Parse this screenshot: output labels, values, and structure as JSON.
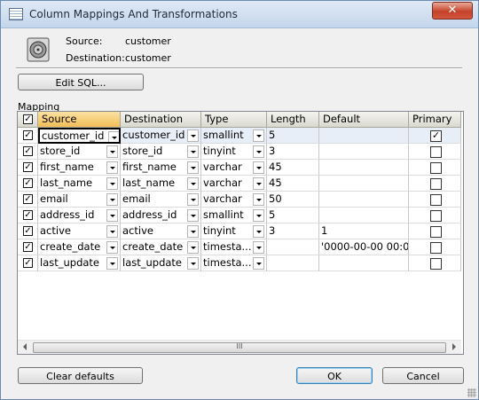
{
  "window": {
    "title": "Column Mappings And Transformations",
    "close_label": "✕"
  },
  "info": {
    "source_label": "Source:",
    "source_value": "customer",
    "destination_label": "Destination:",
    "destination_value": "customer"
  },
  "buttons": {
    "edit_sql": "Edit SQL...",
    "clear_defaults": "Clear defaults",
    "ok": "OK",
    "cancel": "Cancel"
  },
  "mapping_label": "Mapping",
  "columns": {
    "source": "Source",
    "destination": "Destination",
    "type": "Type",
    "length": "Length",
    "default": "Default",
    "primary": "Primary"
  },
  "rows": [
    {
      "checked": true,
      "source": "customer_id",
      "destination": "customer_id",
      "type": "smallint",
      "length": "5",
      "default": "",
      "primary": true
    },
    {
      "checked": true,
      "source": "store_id",
      "destination": "store_id",
      "type": "tinyint",
      "length": "3",
      "default": "",
      "primary": false
    },
    {
      "checked": true,
      "source": "first_name",
      "destination": "first_name",
      "type": "varchar",
      "length": "45",
      "default": "",
      "primary": false
    },
    {
      "checked": true,
      "source": "last_name",
      "destination": "last_name",
      "type": "varchar",
      "length": "45",
      "default": "",
      "primary": false
    },
    {
      "checked": true,
      "source": "email",
      "destination": "email",
      "type": "varchar",
      "length": "50",
      "default": "",
      "primary": false
    },
    {
      "checked": true,
      "source": "address_id",
      "destination": "address_id",
      "type": "smallint",
      "length": "5",
      "default": "",
      "primary": false
    },
    {
      "checked": true,
      "source": "active",
      "destination": "active",
      "type": "tinyint",
      "length": "3",
      "default": "1",
      "primary": false
    },
    {
      "checked": true,
      "source": "create_date",
      "destination": "create_date",
      "type": "timesta...",
      "length": "",
      "default": "'0000-00-00 00:0",
      "primary": false
    },
    {
      "checked": true,
      "source": "last_update",
      "destination": "last_update",
      "type": "timesta...",
      "length": "",
      "default": "",
      "primary": false
    }
  ],
  "scrollbar_thumb_label": "III"
}
